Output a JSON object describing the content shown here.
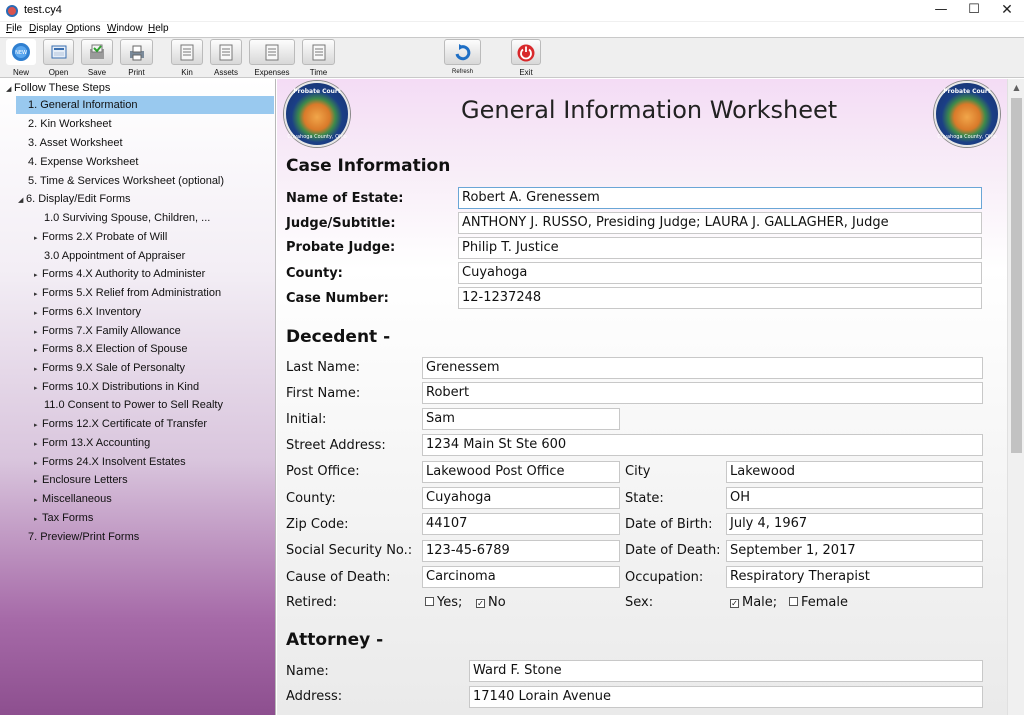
{
  "window": {
    "title": "test.cy4",
    "minimize": "—",
    "maximize": "☐",
    "close": "✕"
  },
  "menu": [
    "File",
    "Display",
    "Options",
    "Window",
    "Help"
  ],
  "toolbar": {
    "new": "New",
    "open": "Open",
    "save": "Save",
    "print": "Print",
    "kin": "Kin",
    "assets": "Assets",
    "expenses": "Expenses",
    "time": "Time",
    "refresh": "Refresh",
    "exit": "Exit"
  },
  "tree": [
    {
      "label": "Follow These Steps",
      "arrow": "◢"
    },
    {
      "label": "1. General Information"
    },
    {
      "label": "2. Kin Worksheet"
    },
    {
      "label": "3. Asset Worksheet"
    },
    {
      "label": "4. Expense Worksheet"
    },
    {
      "label": "5. Time & Services Worksheet (optional)"
    },
    {
      "label": "6. Display/Edit Forms",
      "arrow": "◢"
    },
    {
      "label": "1.0 Surviving Spouse, Children, ..."
    },
    {
      "label": "Forms 2.X Probate of Will",
      "arrow": "▸"
    },
    {
      "label": "3.0 Appointment of Appraiser"
    },
    {
      "label": "Forms 4.X Authority to Administer",
      "arrow": "▸"
    },
    {
      "label": "Forms 5.X Relief from Administration",
      "arrow": "▸"
    },
    {
      "label": "Forms 6.X Inventory",
      "arrow": "▸"
    },
    {
      "label": "Forms 7.X Family Allowance",
      "arrow": "▸"
    },
    {
      "label": "Forms 8.X Election of Spouse",
      "arrow": "▸"
    },
    {
      "label": "Forms 9.X Sale of Personalty",
      "arrow": "▸"
    },
    {
      "label": "Forms 10.X Distributions in Kind",
      "arrow": "▸"
    },
    {
      "label": "11.0 Consent to Power to Sell Realty"
    },
    {
      "label": "Forms 12.X Certificate of Transfer",
      "arrow": "▸"
    },
    {
      "label": "Form 13.X Accounting",
      "arrow": "▸"
    },
    {
      "label": "Forms 24.X Insolvent Estates",
      "arrow": "▸"
    },
    {
      "label": "Enclosure Letters",
      "arrow": "▸"
    },
    {
      "label": "Miscellaneous",
      "arrow": "▸"
    },
    {
      "label": "Tax Forms",
      "arrow": "▸"
    },
    {
      "label": "7. Preview/Print Forms"
    }
  ],
  "seal": {
    "top": "Probate Court",
    "bottom": "Cuyahoga County, Ohio"
  },
  "worksheet": {
    "title": "General Information Worksheet"
  },
  "case": {
    "heading": "Case Information",
    "estate_label": "Name of Estate:",
    "estate": "Robert A. Grenessem",
    "judge_label": "Judge/Subtitle:",
    "judge": "ANTHONY J. RUSSO, Presiding Judge; LAURA J. GALLAGHER, Judge",
    "probate_label": "Probate Judge:",
    "probate": "Philip T. Justice",
    "county_label": "County:",
    "county": "Cuyahoga",
    "number_label": "Case Number:",
    "number": "12-1237248"
  },
  "decedent": {
    "heading": "Decedent -",
    "last_label": "Last Name:",
    "last": "Grenessem",
    "first_label": "First Name:",
    "first": "Robert",
    "initial_label": "Initial:",
    "initial": "Sam",
    "street_label": "Street Address:",
    "street": "1234 Main St Ste 600",
    "po_label": "Post Office:",
    "po": "Lakewood Post Office",
    "city_label": "City",
    "city": "Lakewood",
    "county_label": "County:",
    "county": "Cuyahoga",
    "state_label": "State:",
    "state": "OH",
    "zip_label": "Zip Code:",
    "zip": "44107",
    "dob_label": "Date of Birth:",
    "dob": "July 4, 1967",
    "ssn_label": "Social Security No.:",
    "ssn": "123-45-6789",
    "dod_label": "Date of Death:",
    "dod": "September 1, 2017",
    "cause_label": "Cause of Death:",
    "cause": "Carcinoma",
    "occupation_label": "Occupation:",
    "occupation": "Respiratory Therapist",
    "retired_label": "Retired:",
    "retired_yes": "Yes;",
    "retired_no": "No",
    "retired_value": "No",
    "sex_label": "Sex:",
    "sex_male": "Male;",
    "sex_female": "Female",
    "sex_value": "Male"
  },
  "attorney": {
    "heading": "Attorney -",
    "name_label": "Name:",
    "name": "Ward F. Stone",
    "address_label": "Address:",
    "address": "17140 Lorain Avenue"
  }
}
